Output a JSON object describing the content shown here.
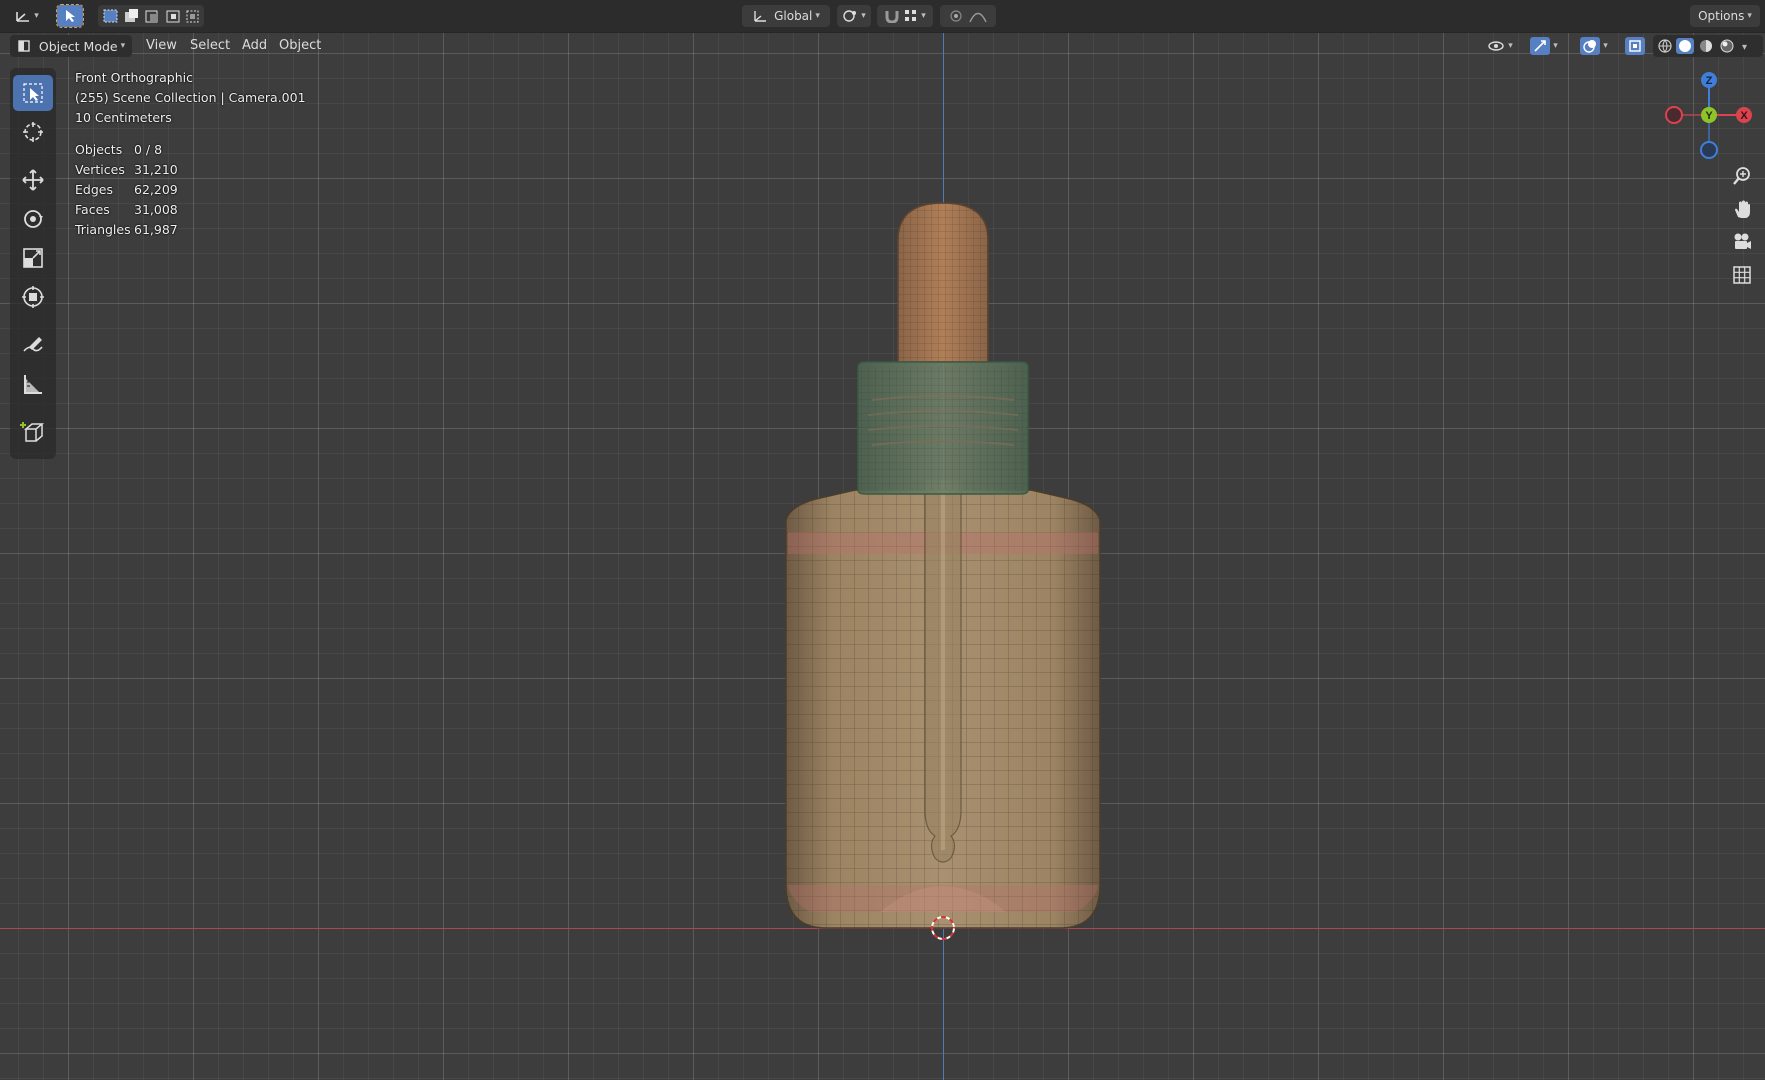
{
  "header": {
    "orientation": "Global",
    "options_label": "Options"
  },
  "menu": {
    "mode_label": "Object Mode",
    "view": "View",
    "select": "Select",
    "add": "Add",
    "object": "Object"
  },
  "overlay": {
    "view_name": "Front Orthographic",
    "collection": "(255) Scene Collection | Camera.001",
    "scale": "10 Centimeters"
  },
  "stats": [
    {
      "label": "Objects",
      "value": "0 / 8"
    },
    {
      "label": "Vertices",
      "value": "31,210"
    },
    {
      "label": "Edges",
      "value": "62,209"
    },
    {
      "label": "Faces",
      "value": "31,008"
    },
    {
      "label": "Triangles",
      "value": "61,987"
    }
  ],
  "gizmo": {
    "z": "Z",
    "y": "Y",
    "x": "X"
  },
  "colors": {
    "accent": "#5680c2",
    "axis_x": "#d9444f",
    "axis_y": "#8ec42a",
    "axis_z": "#3f7fd9"
  },
  "toolbar_icons": [
    "select-box-icon",
    "cursor-icon",
    "move-icon",
    "rotate-icon",
    "scale-icon",
    "transform-icon",
    "annotate-icon",
    "measure-icon",
    "add-cube-icon"
  ],
  "nav_icons": [
    "zoom-icon",
    "pan-hand-icon",
    "camera-icon",
    "grid-icon"
  ]
}
